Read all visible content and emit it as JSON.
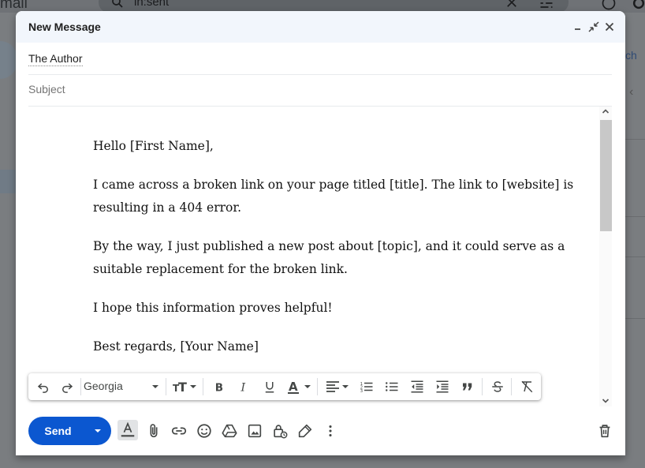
{
  "background": {
    "app_name_fragment": "mail",
    "search_value": "in:sent",
    "right_link_fragment": "ch"
  },
  "compose": {
    "title": "New Message",
    "recipient": "The Author",
    "subject_placeholder": "Subject",
    "body": {
      "greeting": "Hello [First Name],",
      "paragraph1": "I came across a broken link on your page titled [title]. The link to [website] is resulting in a 404 error.",
      "paragraph2": "By the way, I just published a new post about [topic], and it could serve as a suitable replacement for the broken link.",
      "paragraph3": "I hope this information proves helpful!",
      "signoff": "Best regards, [Your Name]"
    },
    "toolbar": {
      "font": "Georgia",
      "icons": [
        "undo-icon",
        "redo-icon",
        "text-size-icon",
        "bold-icon",
        "italic-icon",
        "underline-icon",
        "text-color-icon",
        "align-icon",
        "numbered-list-icon",
        "bulleted-list-icon",
        "indent-less-icon",
        "indent-more-icon",
        "quote-icon",
        "strikethrough-icon",
        "remove-formatting-icon"
      ]
    },
    "bottom": {
      "send_label": "Send",
      "icons": [
        "formatting-options-icon",
        "attach-icon",
        "link-icon",
        "emoji-icon",
        "drive-icon",
        "photo-icon",
        "confidential-icon",
        "signature-icon",
        "more-options-icon",
        "discard-icon"
      ]
    }
  },
  "colors": {
    "accent": "#0b57d0",
    "header_bg": "#f2f6fc",
    "overlay": "#7a7d80"
  }
}
